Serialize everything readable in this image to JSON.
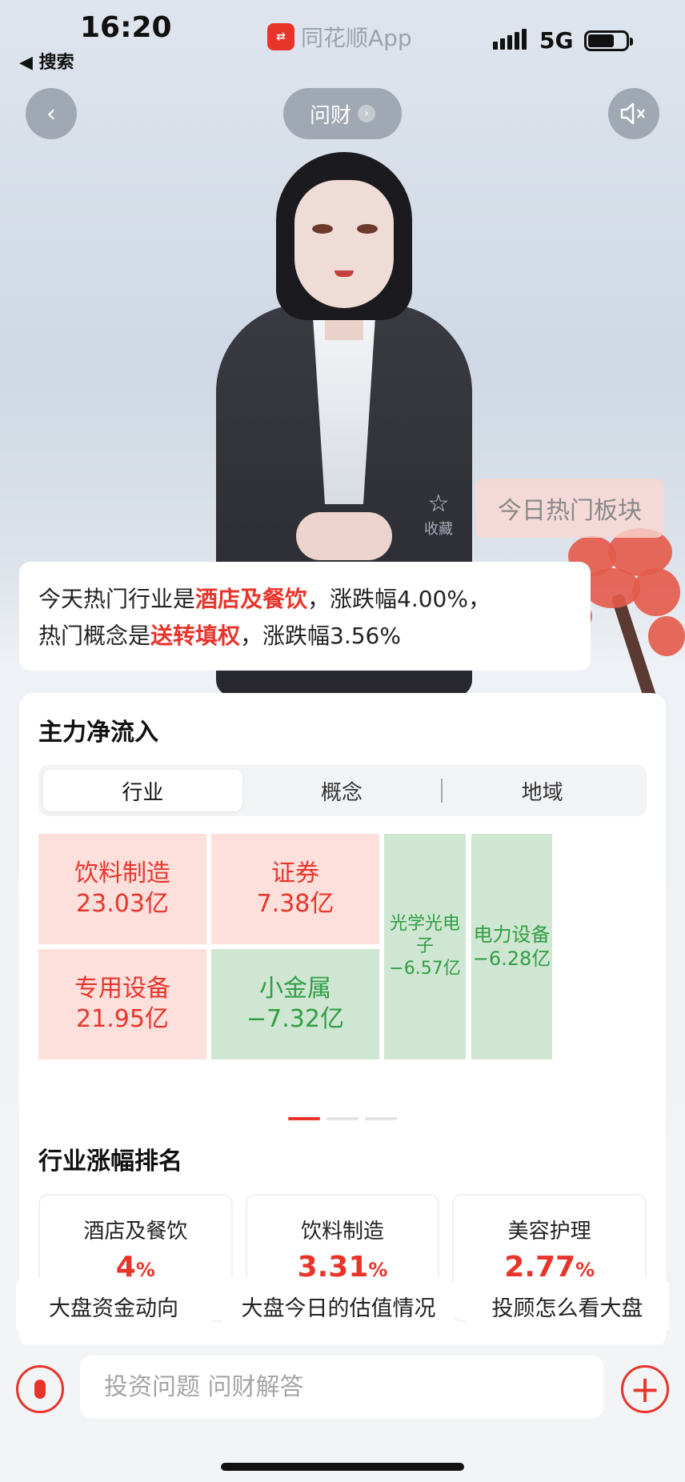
{
  "status": {
    "time": "16:20",
    "back_label": "◀ 搜索",
    "app_name": "同花顺App",
    "network": "5G"
  },
  "top": {
    "wencai_label": "问财"
  },
  "overlay": {
    "hot_sector_label": "今日热门板块",
    "favorite_label": "收藏"
  },
  "bubble": {
    "p1": "今天热门行业是",
    "hl1": "酒店及餐饮",
    "p2": "，涨跌幅4.00%，",
    "p3": "热门概念是",
    "hl2": "送转填权",
    "p4": "，涨跌幅3.56%"
  },
  "main_flow": {
    "title": "主力净流入",
    "tabs": [
      {
        "label": "行业"
      },
      {
        "label": "概念"
      },
      {
        "label": "地域"
      }
    ],
    "cells": [
      {
        "name": "饮料制造",
        "value": "23.03亿"
      },
      {
        "name": "证券",
        "value": "7.38亿"
      },
      {
        "name": "光学光电子",
        "value": "−6.57亿"
      },
      {
        "name": "电力设备",
        "value": "−6.28亿"
      },
      {
        "name": "专用设备",
        "value": "21.95亿"
      },
      {
        "name": "小金属",
        "value": "−7.32亿"
      }
    ]
  },
  "ranking": {
    "title": "行业涨幅排名",
    "items": [
      {
        "name": "酒店及餐饮",
        "value": "4",
        "unit": "%"
      },
      {
        "name": "饮料制造",
        "value": "3.31",
        "unit": "%"
      },
      {
        "name": "美容护理",
        "value": "2.77",
        "unit": "%"
      }
    ]
  },
  "suggestions": [
    "大盘资金动向",
    "大盘今日的估值情况",
    "投顾怎么看大盘"
  ],
  "input": {
    "placeholder": "投资问题 问财解答"
  },
  "colors": {
    "accent": "#e8352b",
    "positive_bg": "#fde0dc",
    "negative_bg": "#cfe6d2",
    "negative_text": "#2f9e44"
  }
}
